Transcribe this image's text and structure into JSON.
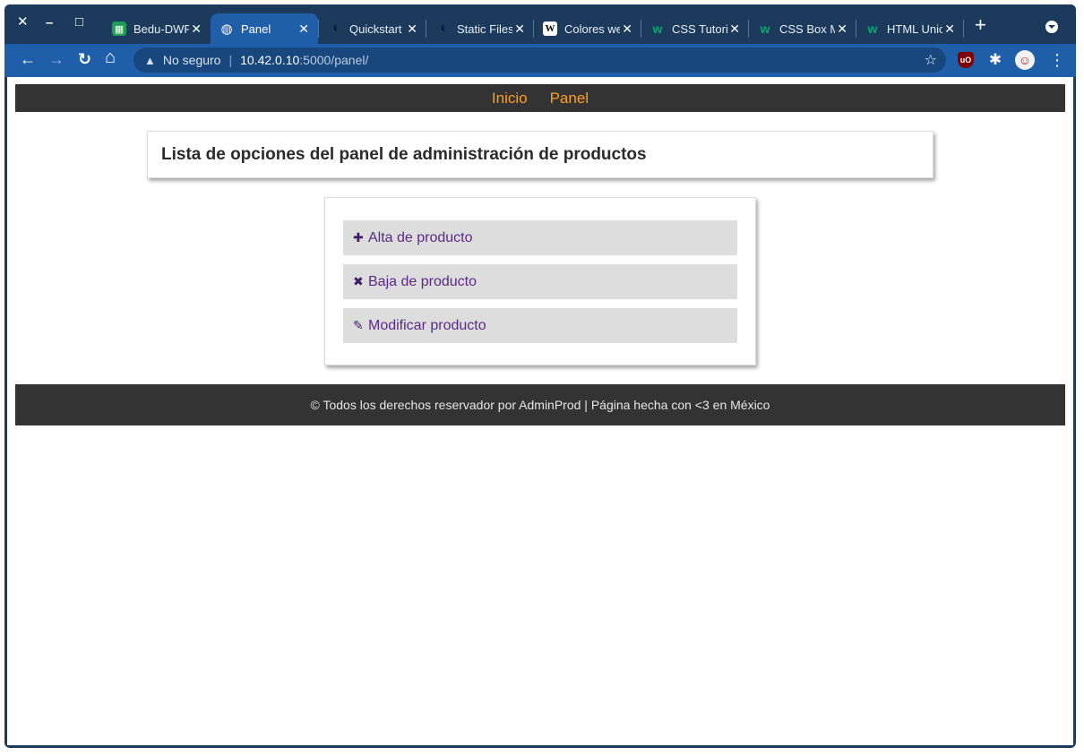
{
  "window_controls": {
    "close": "✕",
    "minimize": "–",
    "maximize": "□"
  },
  "tabs": [
    {
      "title": "Bedu-DWFS",
      "icon": "google-sheets-icon",
      "active": false,
      "favicon_color": "#1e9e53"
    },
    {
      "title": "Panel",
      "icon": "globe-icon",
      "active": true,
      "favicon_color": "#ffffff"
    },
    {
      "title": "Quickstart",
      "icon": "flask-icon",
      "active": false,
      "favicon_color": "#0d1b2a"
    },
    {
      "title": "Static Files",
      "icon": "flask-icon",
      "active": false,
      "favicon_color": "#0d1b2a"
    },
    {
      "title": "Colores web",
      "icon": "wikipedia-icon",
      "active": false,
      "favicon_color": "#ffffff"
    },
    {
      "title": "CSS Tutorial",
      "icon": "w3schools-icon",
      "active": false,
      "favicon_color": "#04aa6d"
    },
    {
      "title": "CSS Box Model",
      "icon": "w3schools-icon",
      "active": false,
      "favicon_color": "#04aa6d"
    },
    {
      "title": "HTML Unicode",
      "icon": "w3schools-icon",
      "active": false,
      "favicon_color": "#04aa6d"
    }
  ],
  "tab_close_glyph": "✕",
  "new_tab_glyph": "+",
  "omnibox": {
    "warning_glyph": "▲",
    "security_text": "No seguro",
    "separator": "|",
    "host": "10.42.0.10",
    "path": ":5000/panel/",
    "star_glyph": "☆"
  },
  "nav_glyphs": {
    "back": "←",
    "forward": "→",
    "reload": "↻",
    "home": "⌂",
    "menu": "⋮"
  },
  "extensions": [
    {
      "name": "ublock-origin-icon",
      "label": "uO",
      "color": "#800000"
    },
    {
      "name": "extensions-puzzle-icon",
      "label": "✱",
      "color": "#1f5ea8"
    },
    {
      "name": "profile-avatar",
      "label": "☺",
      "color": "#f2f2f2"
    }
  ],
  "site_nav": {
    "links": [
      "Inicio",
      "Panel"
    ],
    "link_color": "#ff9e1a"
  },
  "header": {
    "title": "Lista de opciones del panel de administración de productos"
  },
  "options": [
    {
      "icon": "✚",
      "icon_name": "plus-icon",
      "label": "Alta de producto"
    },
    {
      "icon": "✖",
      "icon_name": "x-mark-icon",
      "label": "Baja de producto"
    },
    {
      "icon": "✎",
      "icon_name": "pencil-icon",
      "label": "Modificar producto"
    }
  ],
  "footer": {
    "text": "© Todos los derechos reservador por AdminProd | Página hecha con <3 en México"
  }
}
